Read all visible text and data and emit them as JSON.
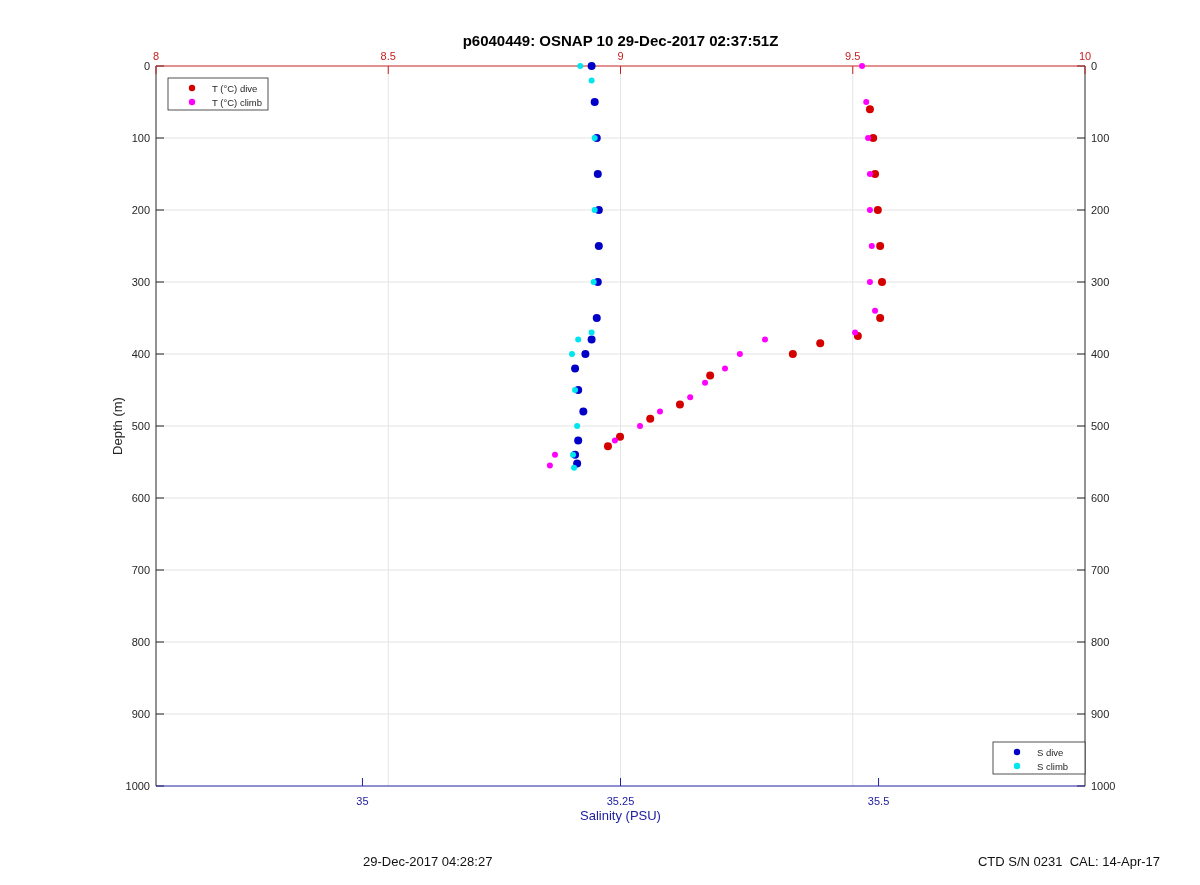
{
  "chart_data": {
    "type": "scatter",
    "title": "p6040449: OSNAP 10 29-Dec-2017 02:37:51Z",
    "xlabel": "Salinity (PSU)",
    "ylabel": "Depth (m)",
    "xlim": [
      34.8,
      35.7
    ],
    "xticks": [
      35,
      35.25,
      35.5
    ],
    "ylim": [
      1000,
      0
    ],
    "yticks": [
      0,
      100,
      200,
      300,
      400,
      500,
      600,
      700,
      800,
      900,
      1000
    ],
    "x2lim": [
      8,
      10
    ],
    "x2ticks": [
      8,
      8.5,
      9,
      9.5,
      10
    ],
    "grid": true,
    "legend": "lower right",
    "series": [
      {
        "name": "T (°C) dive",
        "color": "#d40000",
        "axis": "x2",
        "x": [
          9.537,
          9.544,
          9.548,
          9.554,
          9.559,
          9.563,
          9.559,
          9.511,
          9.43,
          9.371,
          9.193,
          9.128,
          9.064,
          8.999,
          8.973
        ],
        "values": [
          60,
          100,
          150,
          200,
          250,
          300,
          350,
          375,
          385,
          400,
          430,
          470,
          490,
          515,
          528
        ]
      },
      {
        "name": "T (°C) climb",
        "color": "#ff00ff",
        "axis": "x2",
        "x": [
          9.52,
          9.529,
          9.533,
          9.537,
          9.537,
          9.541,
          9.537,
          9.548,
          9.505,
          9.311,
          9.257,
          9.225,
          9.182,
          9.15,
          9.085,
          9.042,
          8.988,
          8.859,
          8.848
        ],
        "values": [
          0,
          50,
          100,
          150,
          200,
          250,
          300,
          340,
          370,
          380,
          400,
          420,
          440,
          460,
          480,
          500,
          520,
          540,
          555
        ]
      },
      {
        "name": "S dive",
        "color": "#0000c8",
        "x": [
          35.222,
          35.225,
          35.227,
          35.228,
          35.229,
          35.229,
          35.228,
          35.227,
          35.222,
          35.216,
          35.206,
          35.209,
          35.214,
          35.209,
          35.206,
          35.208
        ],
        "values": [
          0,
          50,
          100,
          150,
          200,
          250,
          300,
          350,
          380,
          400,
          420,
          450,
          480,
          520,
          540,
          552
        ]
      },
      {
        "name": "S climb",
        "color": "#00e5ee",
        "x": [
          35.211,
          35.222,
          35.225,
          35.225,
          35.224,
          35.222,
          35.209,
          35.203,
          35.206,
          35.208,
          35.204,
          35.205
        ],
        "values": [
          0,
          20,
          100,
          200,
          300,
          370,
          380,
          400,
          450,
          500,
          540,
          558
        ]
      }
    ]
  },
  "right_axis_labels": [
    "0",
    "100",
    "200",
    "300",
    "400",
    "500",
    "600",
    "700",
    "800",
    "900",
    "1000"
  ],
  "footer": {
    "timestamp": "29-Dec-2017 04:28:27",
    "calibration": "CTD S/N 0231  CAL: 14-Apr-17"
  }
}
